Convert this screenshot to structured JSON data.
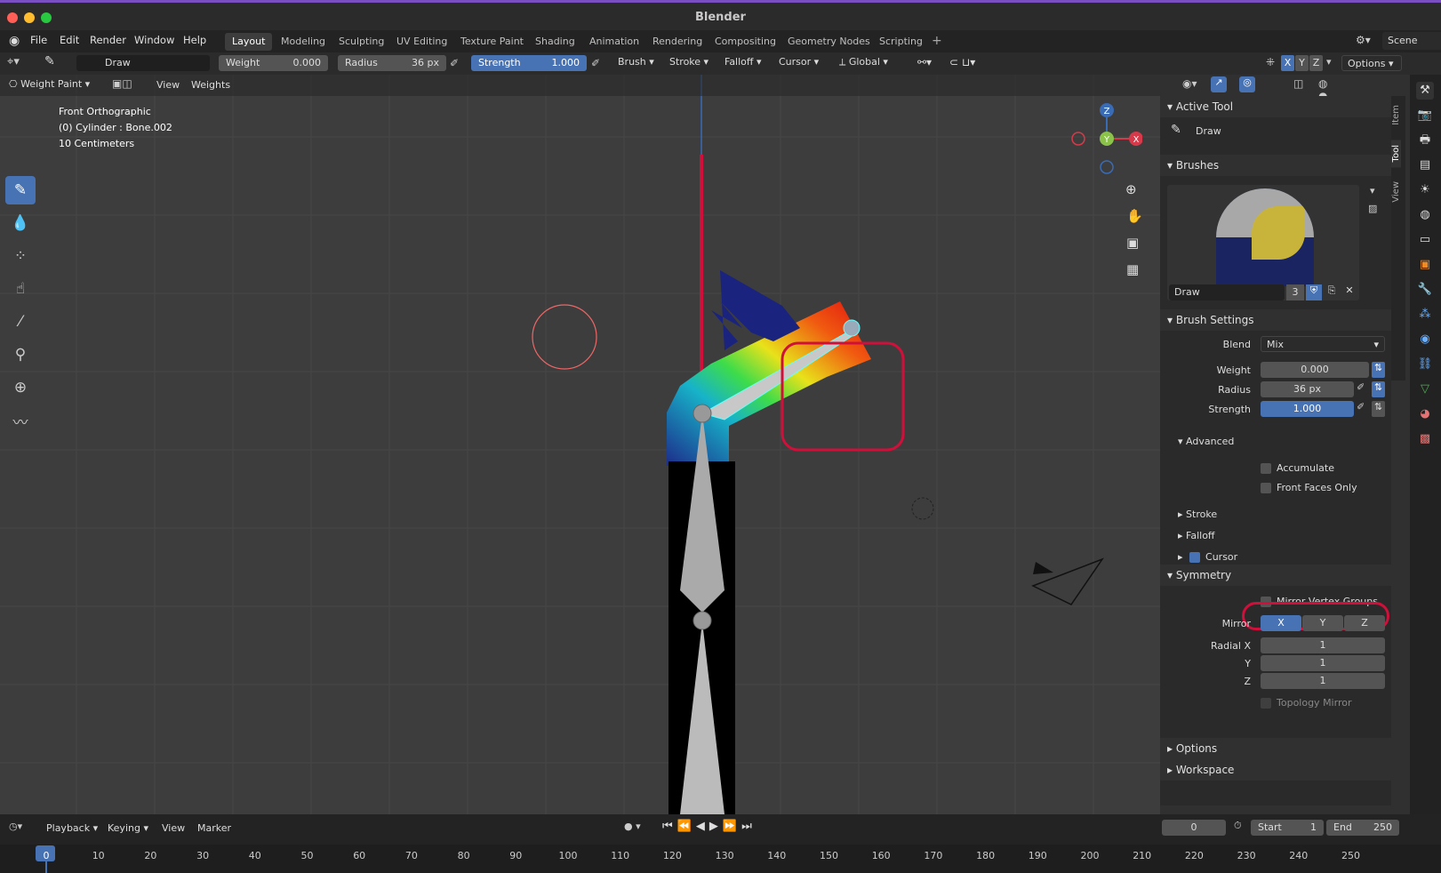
{
  "window": {
    "title": "Blender"
  },
  "menus": [
    "File",
    "Edit",
    "Render",
    "Window",
    "Help"
  ],
  "workspaces": [
    "Layout",
    "Modeling",
    "Sculpting",
    "UV Editing",
    "Texture Paint",
    "Shading",
    "Animation",
    "Rendering",
    "Compositing",
    "Geometry Nodes",
    "Scripting"
  ],
  "active_workspace": "Layout",
  "scene_label": "Scene",
  "tool_header": {
    "brush_name": "Draw",
    "weight_label": "Weight",
    "weight_value": "0.000",
    "radius_label": "Radius",
    "radius_value": "36 px",
    "strength_label": "Strength",
    "strength_value": "1.000",
    "dropdowns": [
      "Brush",
      "Stroke",
      "Falloff",
      "Cursor"
    ],
    "orientation": "Global",
    "axes": [
      "X",
      "Y",
      "Z"
    ],
    "options_label": "Options"
  },
  "viewport_header": {
    "mode": "Weight Paint",
    "view": "View",
    "weights": "Weights"
  },
  "overlay_text": {
    "line1": "Front Orthographic",
    "line2": "(0) Cylinder : Bone.002",
    "line3": "10 Centimeters"
  },
  "gizmo": {
    "z": "Z",
    "y": "Y",
    "x": "X"
  },
  "npanel": {
    "active_tool_header": "Active Tool",
    "active_tool_name": "Draw",
    "brushes_header": "Brushes",
    "brush_name": "Draw",
    "brush_users": "3",
    "brush_settings_header": "Brush Settings",
    "blend_label": "Blend",
    "blend_value": "Mix",
    "weight_label": "Weight",
    "weight_value": "0.000",
    "radius_label": "Radius",
    "radius_value": "36 px",
    "strength_label": "Strength",
    "strength_value": "1.000",
    "advanced_header": "Advanced",
    "accumulate": "Accumulate",
    "front_faces_only": "Front Faces Only",
    "stroke_header": "Stroke",
    "falloff_header": "Falloff",
    "cursor_header": "Cursor",
    "symmetry_header": "Symmetry",
    "mirror_vertex_groups": "Mirror Vertex Groups",
    "mirror_label": "Mirror",
    "mirror_axes": [
      "X",
      "Y",
      "Z"
    ],
    "radial_x_label": "Radial X",
    "radial_x": "1",
    "radial_y_label": "Y",
    "radial_y": "1",
    "radial_z_label": "Z",
    "radial_z": "1",
    "topology_mirror": "Topology Mirror",
    "options_header": "Options",
    "workspace_header": "Workspace"
  },
  "side_tabs": [
    "Item",
    "Tool",
    "View"
  ],
  "timeline": {
    "playback": "Playback",
    "keying": "Keying",
    "view": "View",
    "marker": "Marker",
    "current_frame": "0",
    "start_label": "Start",
    "start_value": "1",
    "end_label": "End",
    "end_value": "250",
    "ticks": [
      "0",
      "10",
      "20",
      "30",
      "40",
      "50",
      "60",
      "70",
      "80",
      "90",
      "100",
      "110",
      "120",
      "130",
      "140",
      "150",
      "160",
      "170",
      "180",
      "190",
      "200",
      "210",
      "220",
      "230",
      "240",
      "250"
    ]
  },
  "colors": {
    "accent": "#4772b3",
    "highlight_circle": "#d0103a",
    "panel_bg": "#2a2a2a",
    "viewport_bg": "#3d3d3d"
  }
}
